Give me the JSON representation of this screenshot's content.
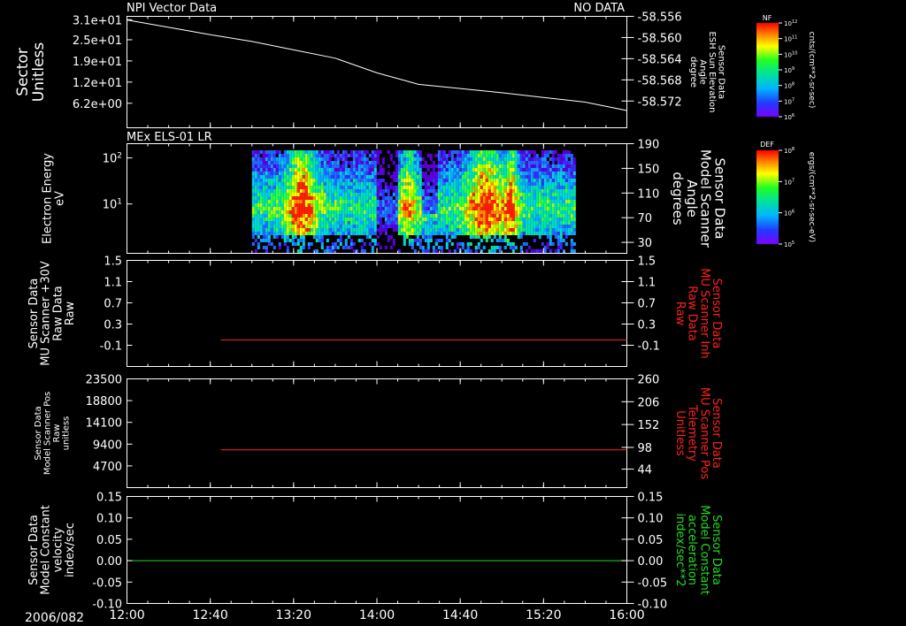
{
  "header": {
    "title_left": "NPI Vector Data",
    "title_right": "NO DATA"
  },
  "time_axis": {
    "date_label": "2006/082",
    "ticks": [
      "12:00",
      "12:40",
      "13:20",
      "14:00",
      "14:40",
      "15:20",
      "16:00"
    ]
  },
  "colors": {
    "background": "#000000",
    "axis": "#ffffff",
    "trace_white": "#ffffff",
    "trace_red": "#ff2020",
    "trace_green": "#22dd22",
    "label_red": "#ff2020",
    "label_green": "#22dd22"
  },
  "chart_data": [
    {
      "type": "line",
      "panel": 1,
      "x_range": [
        "12:00",
        "16:00"
      ],
      "left_axis": {
        "label_lines": [
          "Sector",
          "Unitless"
        ],
        "ticks": [
          "3.1e+01",
          "2.5e+01",
          "1.9e+01",
          "1.2e+01",
          "6.2e+00"
        ]
      },
      "right_axis": {
        "label_lines": [
          "Sensor Data",
          "ESH Sun Elevation",
          "Angle",
          "degree"
        ],
        "ticks": [
          "58.556",
          "58.560",
          "58.564",
          "58.568",
          "58.572"
        ],
        "ylim": [
          -58.5755,
          -58.5542
        ]
      },
      "series": [
        {
          "color": "#ffffff",
          "x": [
            "12:00",
            "12:20",
            "12:40",
            "13:00",
            "13:20",
            "13:40",
            "14:00",
            "14:20",
            "14:40",
            "15:00",
            "15:20",
            "15:40",
            "16:00"
          ],
          "y": [
            -58.5549,
            -58.5563,
            -58.5577,
            -58.559,
            -58.5606,
            -58.5622,
            -58.565,
            -58.5672,
            -58.568,
            -58.5688,
            -58.5697,
            -58.5706,
            -58.5722
          ]
        }
      ],
      "colorbar": {
        "title": "NF",
        "ticks": [
          "10^12",
          "10^11",
          "10^10",
          "10^9",
          "10^8",
          "10^7",
          "10^6"
        ],
        "unit_label": "cnts/(cm**2-sr-sec)"
      }
    },
    {
      "type": "heatmap",
      "panel": 2,
      "title": "MEx ELS-01 LR",
      "x_range": [
        "12:00",
        "16:00"
      ],
      "data_extent_x": [
        "13:00",
        "15:35"
      ],
      "left_axis": {
        "label_lines": [
          "Electron Energy",
          "eV"
        ],
        "scale": "log",
        "ticks": [
          "10^2",
          "10^1"
        ]
      },
      "right_axis": {
        "label_lines": [
          "Sensor Data",
          "Model Scanner",
          "Angle",
          "degrees"
        ],
        "ticks": [
          "190",
          "150",
          "110",
          "70",
          "30"
        ]
      },
      "colorbar": {
        "title": "DEF",
        "ticks": [
          "10^8",
          "10^7",
          "10^6",
          "10^5"
        ],
        "unit_label": "ergs/(cm**2-sr-sec-eV)"
      }
    },
    {
      "type": "line",
      "panel": 3,
      "x_range": [
        "12:00",
        "16:00"
      ],
      "left_axis": {
        "label_lines": [
          "Sensor Data",
          "MU Scanner +30V",
          "Raw Data",
          "Raw"
        ],
        "ticks": [
          "1.5",
          "1.1",
          "0.7",
          "0.3",
          "-0.1"
        ],
        "ylim": [
          -0.5,
          1.5
        ]
      },
      "right_axis": {
        "label_lines": [
          "Sensor Data",
          "MU Scanner Inh",
          "Raw Data",
          "Raw"
        ],
        "ticks": [
          "1.5",
          "1.1",
          "0.7",
          "0.3",
          "-0.1"
        ]
      },
      "series": [
        {
          "color": "#ff2020",
          "x": [
            "12:45",
            "16:00"
          ],
          "y": [
            0.0,
            0.0
          ]
        }
      ]
    },
    {
      "type": "line",
      "panel": 4,
      "x_range": [
        "12:00",
        "16:00"
      ],
      "left_axis": {
        "label_lines": [
          "Sensor Data",
          "Model Scanner Pos",
          "Raw",
          "unitless"
        ],
        "ticks": [
          "23500",
          "18800",
          "14100",
          "9400",
          "4700"
        ],
        "ylim": [
          0,
          23500
        ]
      },
      "right_axis": {
        "label_lines": [
          "Sensor Data",
          "MU Scanner Pos",
          "Telemetry",
          "Unitless"
        ],
        "ticks": [
          "260",
          "206",
          "152",
          "98",
          "44"
        ]
      },
      "series": [
        {
          "color": "#ff2020",
          "x": [
            "12:45",
            "16:00"
          ],
          "y": [
            8150,
            8150
          ]
        }
      ]
    },
    {
      "type": "line",
      "panel": 5,
      "x_range": [
        "12:00",
        "16:00"
      ],
      "left_axis": {
        "label_lines": [
          "Sensor Data",
          "Model Constant",
          "velocity",
          "index/sec"
        ],
        "ticks": [
          "0.15",
          "0.10",
          "0.05",
          "0.00",
          "-0.05",
          "-0.10"
        ],
        "ylim": [
          -0.1,
          0.15
        ]
      },
      "right_axis": {
        "label_lines": [
          "Sensor Data",
          "Model Constant",
          "acceleration",
          "index/sec**2"
        ],
        "ticks": [
          "0.15",
          "0.10",
          "0.05",
          "0.00",
          "-0.05",
          "-0.10"
        ]
      },
      "series": [
        {
          "color": "#22dd22",
          "x": [
            "12:00",
            "16:00"
          ],
          "y": [
            0.0,
            0.0
          ]
        }
      ]
    }
  ]
}
